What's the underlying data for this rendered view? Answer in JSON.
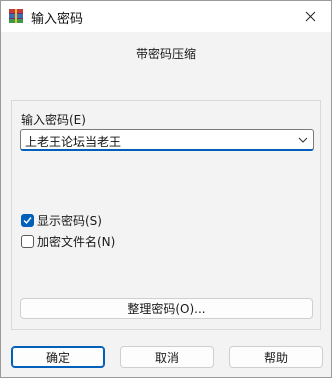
{
  "window": {
    "title": "输入密码",
    "subtitle": "带密码压缩"
  },
  "password": {
    "label": "输入密码(E)",
    "value": "上老王论坛当老王"
  },
  "options": {
    "show_password": {
      "label": "显示密码(S)",
      "checked": true
    },
    "encrypt_filenames": {
      "label": "加密文件名(N)",
      "checked": false
    }
  },
  "buttons": {
    "organize": "整理密码(O)...",
    "ok": "确定",
    "cancel": "取消",
    "help": "帮助"
  },
  "colors": {
    "accent": "#005fb8"
  }
}
